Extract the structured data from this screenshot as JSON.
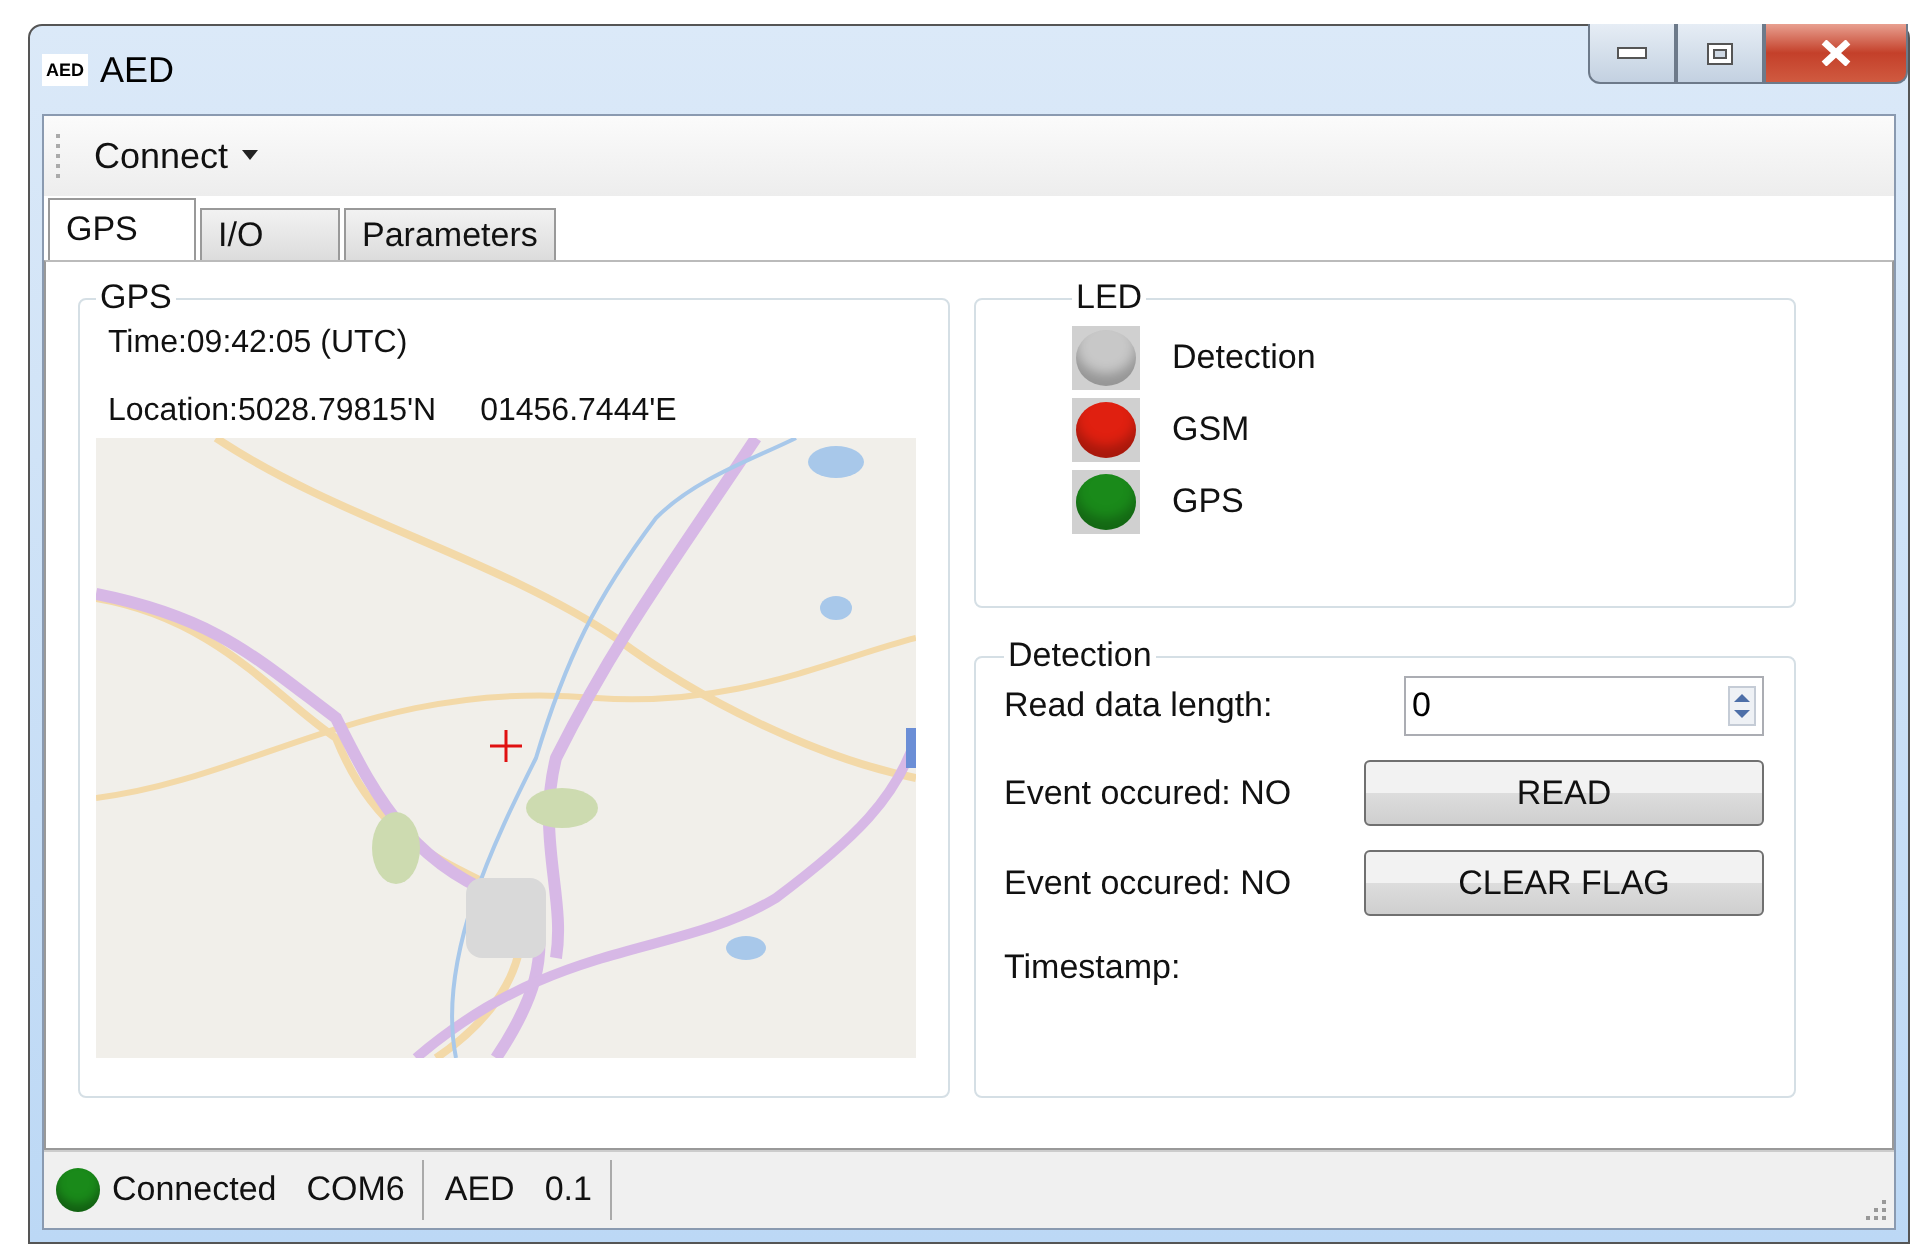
{
  "window": {
    "title": "AED",
    "icon_text": "AED"
  },
  "menu": [
    {
      "label": "Connect"
    }
  ],
  "tabs": [
    {
      "label": "GPS",
      "selected": true
    },
    {
      "label": "I/O",
      "selected": false
    },
    {
      "label": "Parameters",
      "selected": false
    }
  ],
  "gps": {
    "title": "GPS",
    "time": "Time:09:42:05 (UTC)",
    "latitude": "Location:5028.79815'N",
    "longitude": "01456.7444'E"
  },
  "led": {
    "title": "LED",
    "items": [
      {
        "label": "Detection",
        "color": "#c8c8c8"
      },
      {
        "label": "GSM",
        "color": "#e02010"
      },
      {
        "label": "GPS",
        "color": "#1a8a1a"
      }
    ]
  },
  "detection": {
    "title": "Detection",
    "read_length_label": "Read data length:",
    "read_length_value": "0",
    "rows": [
      {
        "status": "Event occured: NO",
        "button": "READ"
      },
      {
        "status": "Event occured: NO",
        "button": "CLEAR FLAG"
      }
    ],
    "timestamp_label": "Timestamp:"
  },
  "status_bar": {
    "sections": [
      {
        "items": [
          {
            "kind": "led",
            "label": "Connected",
            "color": "#1a8a1a"
          },
          {
            "kind": "text",
            "label": "COM6"
          }
        ]
      },
      {
        "items": [
          {
            "kind": "text",
            "label": "AED"
          },
          {
            "kind": "text",
            "label": "0.1"
          }
        ]
      }
    ]
  }
}
